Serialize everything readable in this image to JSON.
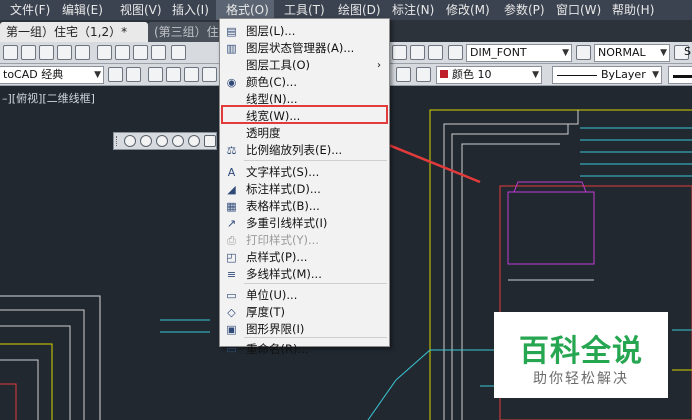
{
  "menubar": {
    "items": [
      "文件(F)",
      "编辑(E)",
      "视图(V)",
      "插入(I)",
      "格式(O)",
      "工具(T)",
      "绘图(D)",
      "标注(N)",
      "修改(M)",
      "参数(P)",
      "窗口(W)",
      "帮助(H)"
    ],
    "active_index": 4
  },
  "tabs": [
    {
      "label": "第一组）住宅（1,2）*",
      "active": true
    },
    {
      "label": "(第三组）住宅",
      "active": false
    }
  ],
  "toolbar1": {
    "font_combo": "DIM_FONT",
    "dimstyle_combo": "NORMAL",
    "extra_label": "S"
  },
  "toolbar2": {
    "workspace_combo": "toCAD 经典",
    "color_combo": "颜色 10",
    "linetype_combo": "ByLayer"
  },
  "viewport": {
    "label": "–][俯视][二维线框]"
  },
  "format_menu": {
    "items": [
      {
        "label": "图层(L)...",
        "icon": "layers-icon",
        "disabled": false,
        "submenu": false
      },
      {
        "label": "图层状态管理器(A)...",
        "icon": "layer-state-icon",
        "disabled": false,
        "submenu": false
      },
      {
        "label": "图层工具(O)",
        "icon": "",
        "disabled": false,
        "submenu": true
      },
      {
        "label": "颜色(C)...",
        "icon": "color-wheel-icon",
        "disabled": false,
        "submenu": false
      },
      {
        "label": "线型(N)...",
        "icon": "",
        "disabled": false,
        "submenu": false
      },
      {
        "label": "线宽(W)...",
        "icon": "",
        "disabled": false,
        "submenu": false
      },
      {
        "label": "透明度",
        "icon": "",
        "disabled": false,
        "submenu": false
      },
      {
        "label": "比例缩放列表(E)...",
        "icon": "scale-list-icon",
        "disabled": false,
        "submenu": false
      },
      {
        "label": "文字样式(S)...",
        "icon": "text-style-icon",
        "disabled": false,
        "submenu": false
      },
      {
        "label": "标注样式(D)...",
        "icon": "dim-style-icon",
        "disabled": false,
        "submenu": false
      },
      {
        "label": "表格样式(B)...",
        "icon": "table-style-icon",
        "disabled": false,
        "submenu": false
      },
      {
        "label": "多重引线样式(I)",
        "icon": "mleader-style-icon",
        "disabled": false,
        "submenu": false
      },
      {
        "label": "打印样式(Y)...",
        "icon": "plot-style-icon",
        "disabled": true,
        "submenu": false
      },
      {
        "label": "点样式(P)...",
        "icon": "point-style-icon",
        "disabled": false,
        "submenu": false
      },
      {
        "label": "多线样式(M)...",
        "icon": "mline-style-icon",
        "disabled": false,
        "submenu": false
      },
      {
        "label": "单位(U)...",
        "icon": "units-icon",
        "disabled": false,
        "submenu": false
      },
      {
        "label": "厚度(T)",
        "icon": "thickness-icon",
        "disabled": false,
        "submenu": false
      },
      {
        "label": "图形界限(I)",
        "icon": "drawing-limits-icon",
        "disabled": false,
        "submenu": false
      },
      {
        "label": "重命名(R)...",
        "icon": "rename-icon",
        "disabled": false,
        "submenu": false
      }
    ],
    "highlighted_index": 5
  },
  "watermark": {
    "logo": "百科全说",
    "subtitle": "助你轻松解决"
  },
  "colors": {
    "highlight_box": "#e23b3b",
    "arrow": "#e23b3b",
    "canvas_bg": "#212830"
  }
}
